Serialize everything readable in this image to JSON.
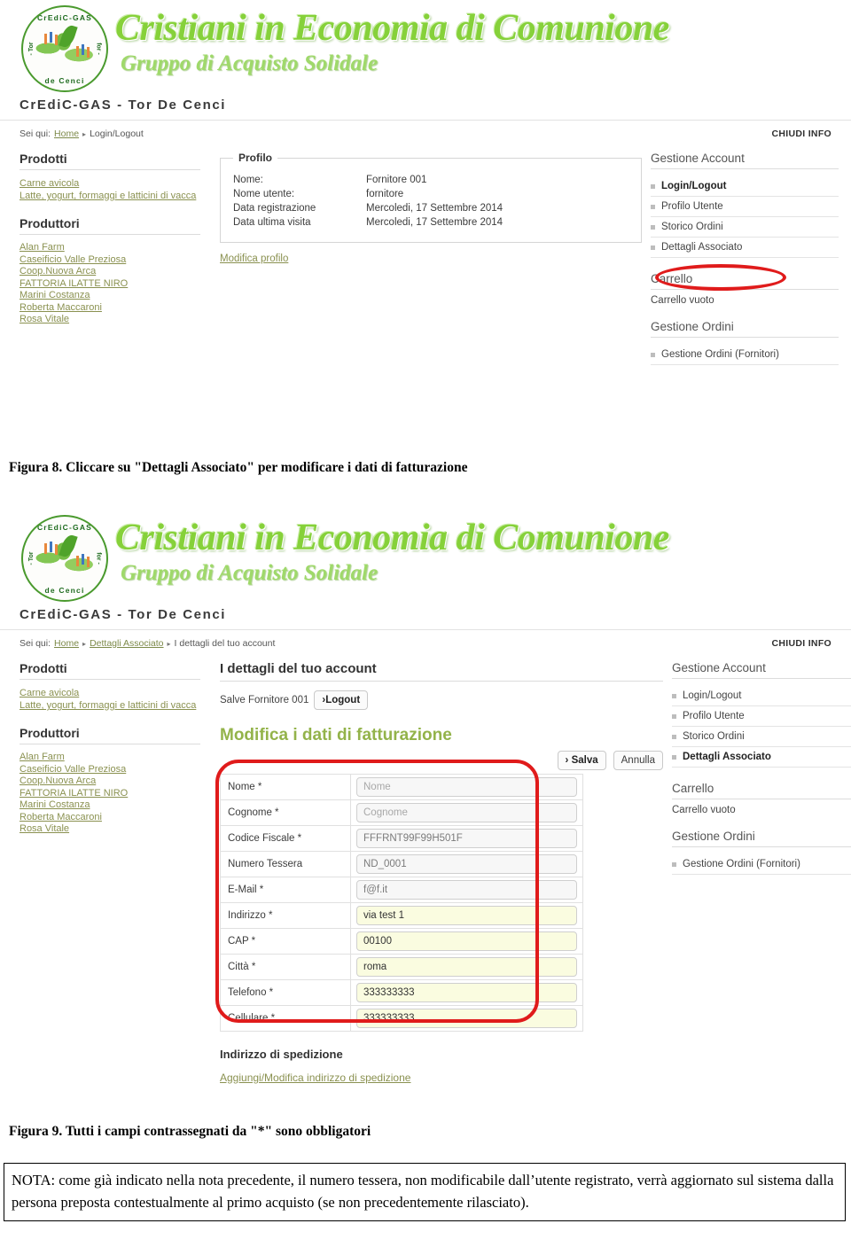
{
  "document": {
    "figure8_caption": "Figura 8. Cliccare su \"Dettagli Associato\" per modificare i dati di fatturazione",
    "figure9_caption": "Figura 9. Tutti i campi contrassegnati da \"*\" sono obbligatori",
    "nota": "NOTA: come già indicato nella nota precedente, il numero tessera, non modificabile dall’utente registrato, verrà aggiornato sul sistema dalla persona preposta contestualmente al primo acquisto (se non precedentemente rilasciato)."
  },
  "brand": {
    "logo_ring_top": "CrEdiC-GAS",
    "logo_ring_bottom": "de Cenci",
    "logo_ring_left": "- Tor",
    "logo_ring_right": "for -",
    "title": "Cristiani in Economia di Comunione",
    "subtitle": "Gruppo di Acquisto Solidale",
    "site_title": "CrEdiC-GAS - Tor De Cenci",
    "accent_green": "#86d13a",
    "link_green": "#8a9150",
    "highlight_red": "#e01b1b",
    "field_yellow": "#fafce0"
  },
  "shot1": {
    "breadcrumb": {
      "label": "Sei qui:",
      "home": "Home",
      "separator": "▸",
      "current": "Login/Logout"
    },
    "chiudi_info": "CHIUDI INFO",
    "left": {
      "prodotti_title": "Prodotti",
      "prodotti": [
        "Carne avicola",
        "Latte, yogurt, formaggi e latticini di vacca"
      ],
      "produttori_title": "Produttori",
      "produttori": [
        "Alan Farm",
        "Caseificio Valle Preziosa",
        "Coop.Nuova Arca",
        "FATTORIA ILATTE NIRO",
        "Marini Costanza",
        "Roberta Maccaroni",
        "Rosa Vitale"
      ]
    },
    "profile": {
      "legend": "Profilo",
      "rows": [
        {
          "key": "Nome:",
          "value": "Fornitore 001"
        },
        {
          "key": "Nome utente:",
          "value": "fornitore"
        },
        {
          "key": "Data registrazione",
          "value": "Mercoledi, 17 Settembre 2014"
        },
        {
          "key": "Data ultima visita",
          "value": "Mercoledi, 17 Settembre 2014"
        }
      ],
      "edit_link": "Modifica profilo"
    },
    "right": {
      "account_title": "Gestione Account",
      "account_items": [
        "Login/Logout",
        "Profilo Utente",
        "Storico Ordini",
        "Dettagli Associato"
      ],
      "cart_title": "Carrello",
      "cart_status": "Carrello vuoto",
      "orders_title": "Gestione Ordini",
      "orders_items": [
        "Gestione Ordini (Fornitori)"
      ]
    }
  },
  "shot2": {
    "breadcrumb": {
      "label": "Sei qui:",
      "home": "Home",
      "separator": "▸",
      "mid": "Dettagli Associato",
      "current": "I dettagli del tuo account"
    },
    "chiudi_info": "CHIUDI INFO",
    "left": {
      "prodotti_title": "Prodotti",
      "prodotti": [
        "Carne avicola",
        "Latte, yogurt, formaggi e latticini di vacca"
      ],
      "produttori_title": "Produttori",
      "produttori": [
        "Alan Farm",
        "Caseificio Valle Preziosa",
        "Coop.Nuova Arca",
        "FATTORIA ILATTE NIRO",
        "Marini Costanza",
        "Roberta Maccaroni",
        "Rosa Vitale"
      ]
    },
    "main": {
      "heading": "I dettagli del tuo account",
      "greeting": "Salve Fornitore 001",
      "logout_button": "›Logout",
      "form_heading": "Modifica i dati di fatturazione",
      "save_button": "› Salva",
      "cancel_button": "Annulla",
      "fields": [
        {
          "label": "Nome *",
          "value": "Nome",
          "state": "placeholder"
        },
        {
          "label": "Cognome *",
          "value": "Cognome",
          "state": "placeholder"
        },
        {
          "label": "Codice Fiscale *",
          "value": "FFFRNT99F99H501F",
          "state": "readonly"
        },
        {
          "label": "Numero Tessera",
          "value": "ND_0001",
          "state": "readonly"
        },
        {
          "label": "E-Mail *",
          "value": "f@f.it",
          "state": "readonly"
        },
        {
          "label": "Indirizzo *",
          "value": "via test 1",
          "state": "filled"
        },
        {
          "label": "CAP *",
          "value": "00100",
          "state": "filled"
        },
        {
          "label": "Città *",
          "value": "roma",
          "state": "filled"
        },
        {
          "label": "Telefono *",
          "value": "333333333",
          "state": "filled"
        },
        {
          "label": "Cellulare *",
          "value": "333333333",
          "state": "filled"
        }
      ],
      "shipping_heading": "Indirizzo di spedizione",
      "shipping_link": "Aggiungi/Modifica indirizzo di spedizione"
    },
    "right": {
      "account_title": "Gestione Account",
      "account_items": [
        "Login/Logout",
        "Profilo Utente",
        "Storico Ordini",
        "Dettagli Associato"
      ],
      "cart_title": "Carrello",
      "cart_status": "Carrello vuoto",
      "orders_title": "Gestione Ordini",
      "orders_items": [
        "Gestione Ordini (Fornitori)"
      ]
    }
  }
}
